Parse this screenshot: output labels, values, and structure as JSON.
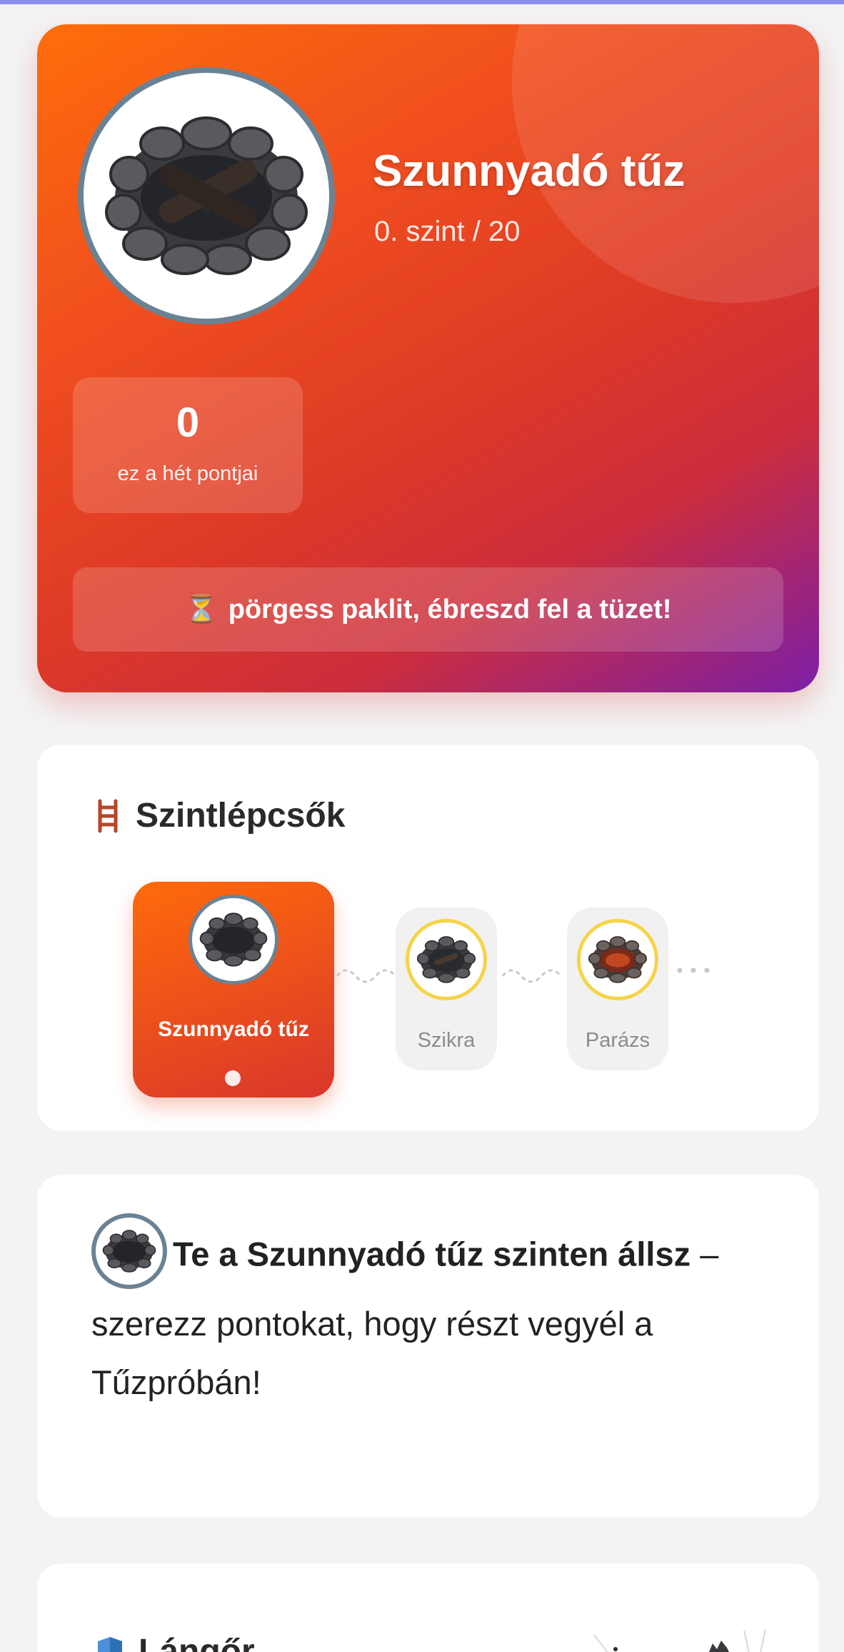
{
  "hero": {
    "title": "Szunnyadó tűz",
    "level_text": "0. szint / 20",
    "points_value": "0",
    "points_label": "ez a hét pontjai",
    "cta_icon": "⏳",
    "cta_text": "pörgess paklit, ébreszd fel a tüzet!"
  },
  "ladder": {
    "title": "Szintlépcsők",
    "icon": "ladder-icon",
    "levels": [
      {
        "label": "Szunnyadó tűz",
        "active": true
      },
      {
        "label": "Szikra",
        "active": false
      },
      {
        "label": "Parázs",
        "active": false
      }
    ]
  },
  "status": {
    "strong_text": "Te a Szunnyadó tűz szinten állsz",
    "rest_text": " – szerezz pontokat, hogy részt vegyél a Tűzpróbán!"
  },
  "guard": {
    "title": "Lángőr",
    "icon": "shield-icon"
  },
  "colors": {
    "hero_gradient_start": "#ff6d0a",
    "hero_gradient_end": "#7c1fa6",
    "avatar_border": "#6a8394",
    "upcoming_border": "#f5d44a",
    "shield_blue": "#4a90d9"
  }
}
